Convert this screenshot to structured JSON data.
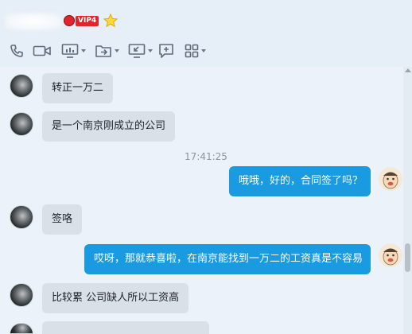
{
  "header": {
    "contact_name": "",
    "vip_label": "VIP4",
    "toolbar_icons": [
      "phone-icon",
      "video-call-icon",
      "screen-share-icon",
      "file-transfer-icon",
      "remote-desktop-icon",
      "add-icon",
      "apps-grid-icon"
    ]
  },
  "chat": {
    "timestamp": "17:41:25",
    "messages": [
      {
        "side": "in",
        "text": "转正一万二"
      },
      {
        "side": "in",
        "text": "是一个南京刚成立的公司"
      },
      {
        "side": "out",
        "text": "哦哦，好的，合同签了吗？"
      },
      {
        "side": "in",
        "text": "签咯"
      },
      {
        "side": "out",
        "text": "哎呀，那就恭喜啦，在南京能找到一万二的工资真是不容易"
      },
      {
        "side": "in",
        "text": "比较累 公司缺人所以工资高"
      }
    ]
  },
  "colors": {
    "outgoing_bubble": "#1a9ae0",
    "incoming_bubble": "#d9e0e8",
    "background": "#ebf2f9"
  }
}
